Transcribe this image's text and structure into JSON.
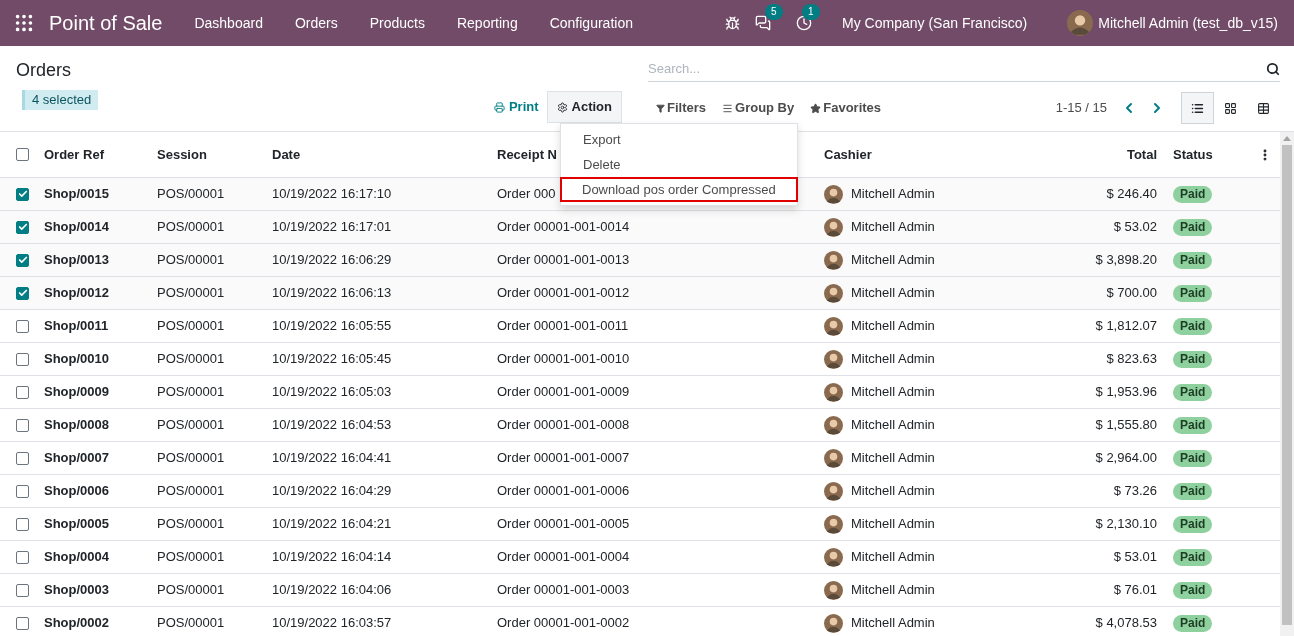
{
  "navbar": {
    "app_title": "Point of Sale",
    "menu": [
      "Dashboard",
      "Orders",
      "Products",
      "Reporting",
      "Configuration"
    ],
    "messages_count": "5",
    "activities_count": "1",
    "company": "My Company (San Francisco)",
    "user": "Mitchell Admin (test_db_v15)"
  },
  "breadcrumb": "Orders",
  "selection_badge": "4 selected",
  "search": {
    "placeholder": "Search..."
  },
  "buttons": {
    "print": "Print",
    "action": "Action",
    "filters": "Filters",
    "group_by": "Group By",
    "favorites": "Favorites"
  },
  "pager": "1-15 / 15",
  "views": [
    {
      "kind": "list",
      "selected": true
    },
    {
      "kind": "kanban",
      "selected": false
    },
    {
      "kind": "pivot",
      "selected": false
    }
  ],
  "action_menu": {
    "items": [
      {
        "label": "Export",
        "highlighted": false
      },
      {
        "label": "Delete",
        "highlighted": false
      },
      {
        "label": "Download pos order Compressed",
        "highlighted": true
      }
    ]
  },
  "table": {
    "select_all_checked": false,
    "columns": [
      "Order Ref",
      "Session",
      "Date",
      "Receipt N",
      "Cashier",
      "Total",
      "Status"
    ],
    "rows": [
      {
        "checked": true,
        "ref": "Shop/0015",
        "session": "POS/00001",
        "date": "10/19/2022 16:17:10",
        "receipt": "Order 000",
        "cashier": "Mitchell Admin",
        "total": "$ 246.40",
        "status": "Paid"
      },
      {
        "checked": true,
        "ref": "Shop/0014",
        "session": "POS/00001",
        "date": "10/19/2022 16:17:01",
        "receipt": "Order 00001-001-0014",
        "cashier": "Mitchell Admin",
        "total": "$ 53.02",
        "status": "Paid"
      },
      {
        "checked": true,
        "ref": "Shop/0013",
        "session": "POS/00001",
        "date": "10/19/2022 16:06:29",
        "receipt": "Order 00001-001-0013",
        "cashier": "Mitchell Admin",
        "total": "$ 3,898.20",
        "status": "Paid"
      },
      {
        "checked": true,
        "ref": "Shop/0012",
        "session": "POS/00001",
        "date": "10/19/2022 16:06:13",
        "receipt": "Order 00001-001-0012",
        "cashier": "Mitchell Admin",
        "total": "$ 700.00",
        "status": "Paid"
      },
      {
        "checked": false,
        "ref": "Shop/0011",
        "session": "POS/00001",
        "date": "10/19/2022 16:05:55",
        "receipt": "Order 00001-001-0011",
        "cashier": "Mitchell Admin",
        "total": "$ 1,812.07",
        "status": "Paid"
      },
      {
        "checked": false,
        "ref": "Shop/0010",
        "session": "POS/00001",
        "date": "10/19/2022 16:05:45",
        "receipt": "Order 00001-001-0010",
        "cashier": "Mitchell Admin",
        "total": "$ 823.63",
        "status": "Paid"
      },
      {
        "checked": false,
        "ref": "Shop/0009",
        "session": "POS/00001",
        "date": "10/19/2022 16:05:03",
        "receipt": "Order 00001-001-0009",
        "cashier": "Mitchell Admin",
        "total": "$ 1,953.96",
        "status": "Paid"
      },
      {
        "checked": false,
        "ref": "Shop/0008",
        "session": "POS/00001",
        "date": "10/19/2022 16:04:53",
        "receipt": "Order 00001-001-0008",
        "cashier": "Mitchell Admin",
        "total": "$ 1,555.80",
        "status": "Paid"
      },
      {
        "checked": false,
        "ref": "Shop/0007",
        "session": "POS/00001",
        "date": "10/19/2022 16:04:41",
        "receipt": "Order 00001-001-0007",
        "cashier": "Mitchell Admin",
        "total": "$ 2,964.00",
        "status": "Paid"
      },
      {
        "checked": false,
        "ref": "Shop/0006",
        "session": "POS/00001",
        "date": "10/19/2022 16:04:29",
        "receipt": "Order 00001-001-0006",
        "cashier": "Mitchell Admin",
        "total": "$ 73.26",
        "status": "Paid"
      },
      {
        "checked": false,
        "ref": "Shop/0005",
        "session": "POS/00001",
        "date": "10/19/2022 16:04:21",
        "receipt": "Order 00001-001-0005",
        "cashier": "Mitchell Admin",
        "total": "$ 2,130.10",
        "status": "Paid"
      },
      {
        "checked": false,
        "ref": "Shop/0004",
        "session": "POS/00001",
        "date": "10/19/2022 16:04:14",
        "receipt": "Order 00001-001-0004",
        "cashier": "Mitchell Admin",
        "total": "$ 53.01",
        "status": "Paid"
      },
      {
        "checked": false,
        "ref": "Shop/0003",
        "session": "POS/00001",
        "date": "10/19/2022 16:04:06",
        "receipt": "Order 00001-001-0003",
        "cashier": "Mitchell Admin",
        "total": "$ 76.01",
        "status": "Paid"
      },
      {
        "checked": false,
        "ref": "Shop/0002",
        "session": "POS/00001",
        "date": "10/19/2022 16:03:57",
        "receipt": "Order 00001-001-0002",
        "cashier": "Mitchell Admin",
        "total": "$ 4,078.53",
        "status": "Paid"
      }
    ]
  }
}
